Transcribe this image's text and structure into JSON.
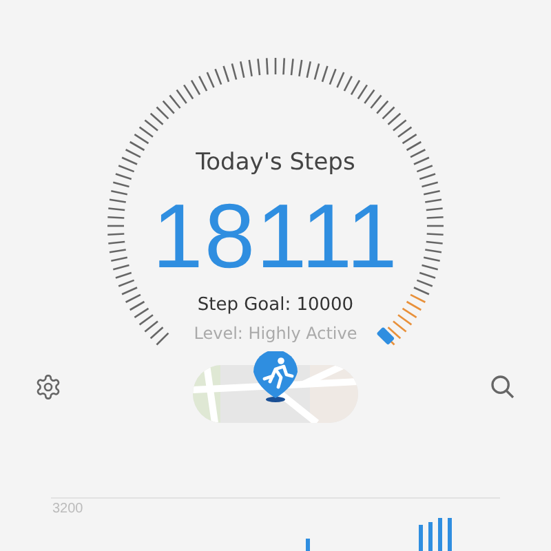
{
  "step_gauge": {
    "title": "Today's Steps",
    "steps": "18111",
    "goal": "Step Goal: 10000",
    "activity_level": "Level: Highly Active"
  },
  "chart": {
    "axis_label": "3200"
  }
}
